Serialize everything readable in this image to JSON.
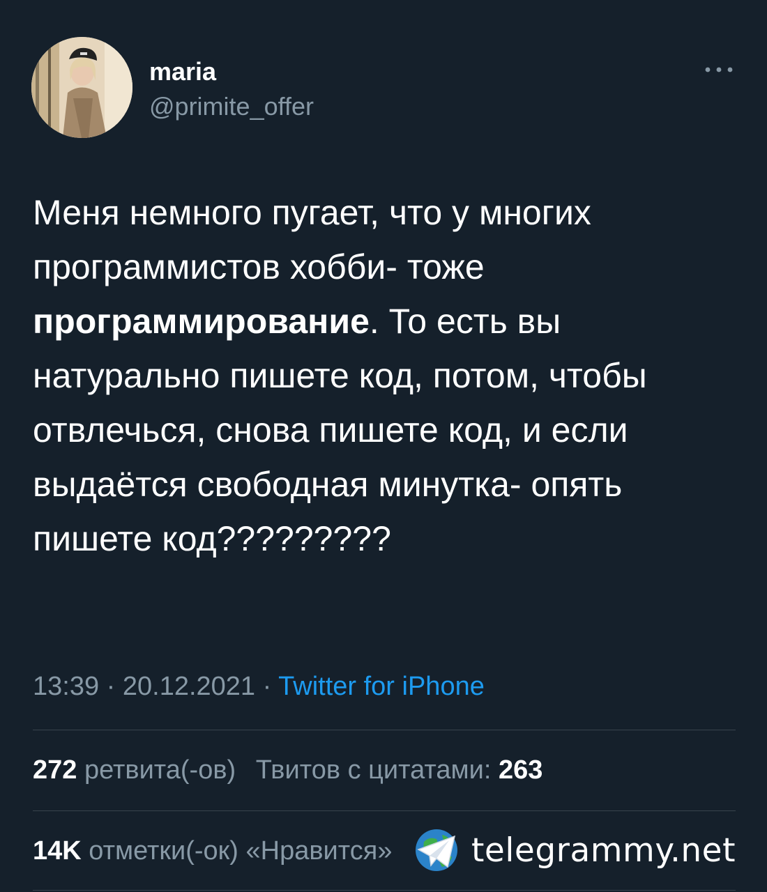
{
  "user": {
    "display_name": "maria",
    "handle": "@primite_offer"
  },
  "menu": {
    "icon": "more-horizontal-icon"
  },
  "tweet": {
    "text_part1": "Меня немного пугает, что у многих программистов хобби- тоже ",
    "text_bold": "программирование",
    "text_part2": ". То есть вы натурально пишете код, потом, чтобы отвлечься, снова пишете код, и если выдаётся свободная минутка- опять пишете код?????????"
  },
  "meta": {
    "time": "13:39",
    "date": "20.12.2021",
    "separator": "·",
    "source": "Twitter for iPhone"
  },
  "stats": {
    "retweets_count": "272",
    "retweets_label": "ретвита(-ов)",
    "quotes_label": "Твитов с цитатами:",
    "quotes_count": "263",
    "likes_count": "14K",
    "likes_label": "отметки(-ок) «Нравится»"
  },
  "watermark": {
    "text": "telegrammy.net",
    "icon": "telegram-globe-icon"
  },
  "colors": {
    "background": "#15202b",
    "text": "#ffffff",
    "secondary": "#8899a6",
    "link": "#1d9bf0",
    "divider": "#38444d"
  }
}
